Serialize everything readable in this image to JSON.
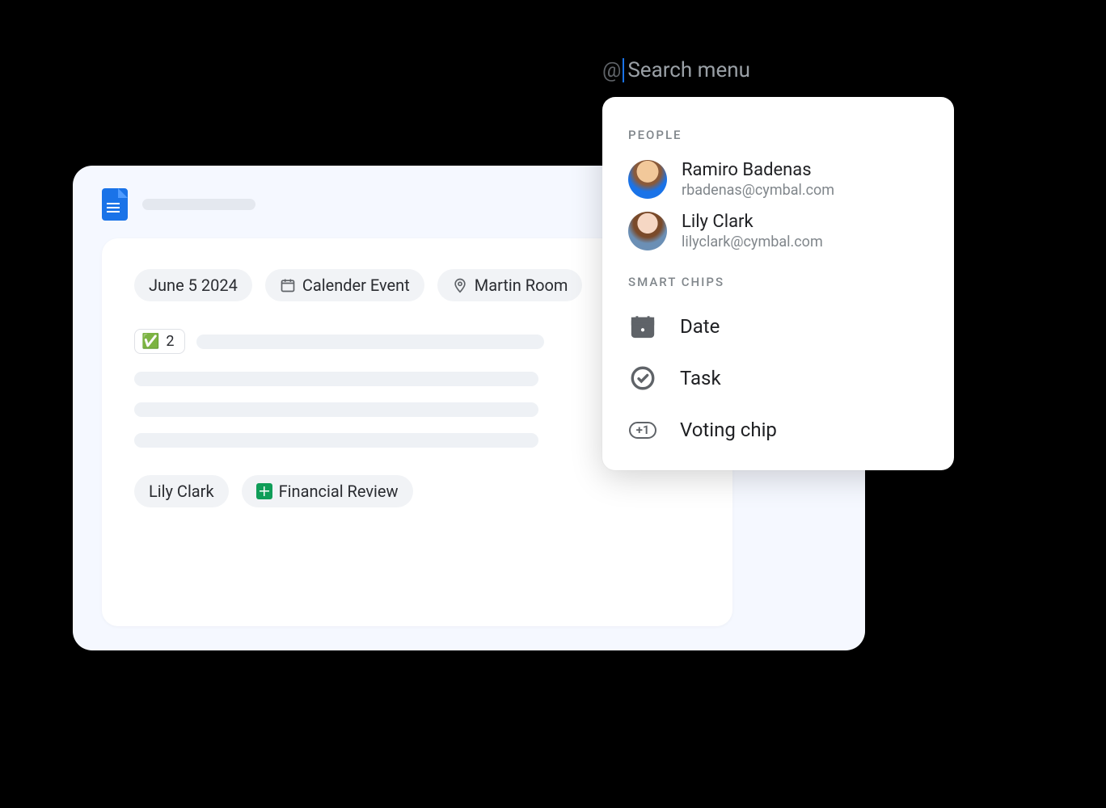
{
  "doc": {
    "chips_top": {
      "date": "June 5 2024",
      "event": "Calender Event",
      "location": "Martin Room"
    },
    "vote_count": "2",
    "chips_bottom": {
      "person": "Lily Clark",
      "file": "Financial Review"
    }
  },
  "at_menu": {
    "at_symbol": "@",
    "placeholder": "Search menu",
    "section_people": "PEOPLE",
    "section_chips": "SMART CHIPS",
    "people": [
      {
        "name": "Ramiro Badenas",
        "email": "rbadenas@cymbal.com"
      },
      {
        "name": "Lily Clark",
        "email": "lilyclark@cymbal.com"
      }
    ],
    "chip_options": {
      "date": "Date",
      "task": "Task",
      "voting": "Voting chip"
    },
    "plus_one_label": "+1"
  }
}
